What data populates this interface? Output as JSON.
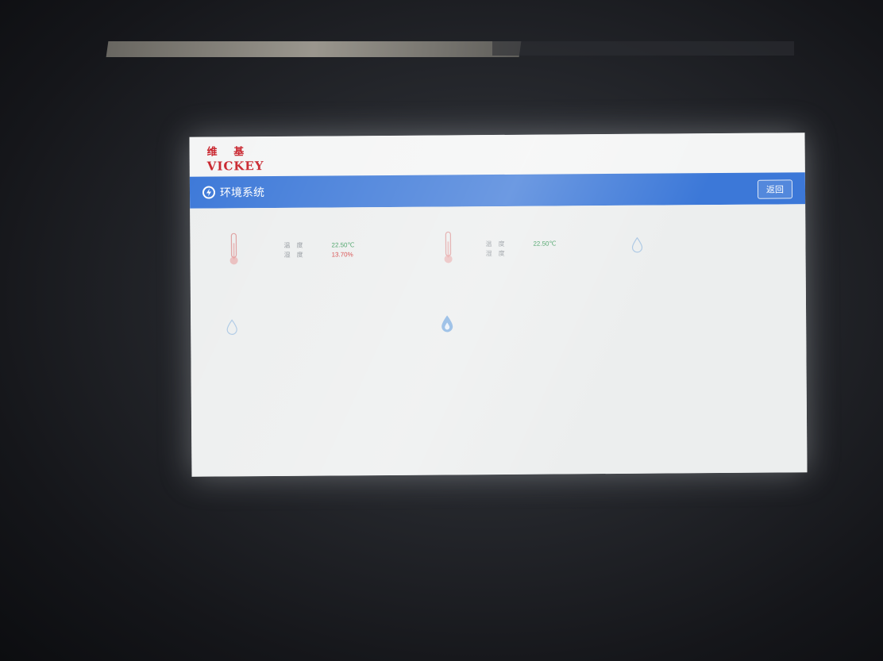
{
  "header": {
    "logo_cn": "维 基",
    "logo_en": "VICKEY",
    "info_line1": "",
    "info_line2": "",
    "info_line3": "",
    "box_line1": "",
    "box_line2": "",
    "user_line1": "",
    "user_line2": ""
  },
  "titlebar": {
    "title": "环境系统",
    "return_label": "返回"
  },
  "devices": [
    {
      "name": "",
      "rows": [
        {
          "label": "温　度",
          "value": "22.50℃",
          "color": "green"
        },
        {
          "label": "湿　度",
          "value": "13.70%",
          "color": "red"
        },
        {
          "label": "",
          "value": "",
          "color": "ok"
        }
      ]
    },
    {
      "name": "",
      "rows": [
        {
          "label": "温　度",
          "value": "22.50℃",
          "color": "green"
        },
        {
          "label": "湿　度",
          "value": "",
          "color": "red"
        },
        {
          "label": "",
          "value": "",
          "color": "ok"
        }
      ]
    },
    {
      "name": "",
      "inline_label": "",
      "inline_value": ""
    },
    {
      "name": "",
      "inline_label": "",
      "inline_value": ""
    },
    {
      "name": "",
      "inline_label": "",
      "inline_value": ""
    }
  ],
  "colors": {
    "titlebar": "#3c78d8",
    "logo": "#c8222b",
    "value_green": "#3a9a5a",
    "value_red": "#d33a3a"
  },
  "icons": [
    "lightning-icon",
    "thermometer-icon",
    "thermometer-icon",
    "water-drop-icon",
    "water-drop-icon",
    "fire-drop-icon"
  ]
}
